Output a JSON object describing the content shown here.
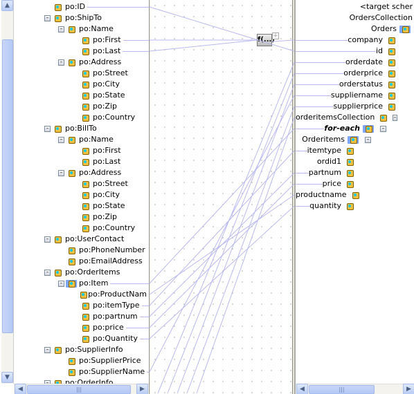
{
  "source_tree": [
    {
      "label": "po:ID",
      "level": 0,
      "toggle": false
    },
    {
      "label": "po:ShipTo",
      "level": 0,
      "toggle": true
    },
    {
      "label": "po:Name",
      "level": 1,
      "toggle": true
    },
    {
      "label": "po:First",
      "level": 2
    },
    {
      "label": "po:Last",
      "level": 2
    },
    {
      "label": "po:Address",
      "level": 1,
      "toggle": true
    },
    {
      "label": "po:Street",
      "level": 2
    },
    {
      "label": "po:City",
      "level": 2
    },
    {
      "label": "po:State",
      "level": 2
    },
    {
      "label": "po:Zip",
      "level": 2
    },
    {
      "label": "po:Country",
      "level": 2
    },
    {
      "label": "po:BillTo",
      "level": 0,
      "toggle": true
    },
    {
      "label": "po:Name",
      "level": 1,
      "toggle": true
    },
    {
      "label": "po:First",
      "level": 2
    },
    {
      "label": "po:Last",
      "level": 2
    },
    {
      "label": "po:Address",
      "level": 1,
      "toggle": true
    },
    {
      "label": "po:Street",
      "level": 2
    },
    {
      "label": "po:City",
      "level": 2
    },
    {
      "label": "po:State",
      "level": 2
    },
    {
      "label": "po:Zip",
      "level": 2
    },
    {
      "label": "po:Country",
      "level": 2
    },
    {
      "label": "po:UserContact",
      "level": 0,
      "toggle": true
    },
    {
      "label": "po:PhoneNumber",
      "level": 1
    },
    {
      "label": "po:EmailAddress",
      "level": 1
    },
    {
      "label": "po:OrderItems",
      "level": 0,
      "toggle": true
    },
    {
      "label": "po:Item",
      "level": 1,
      "toggle": true,
      "multi": true
    },
    {
      "label": "po:ProductNam",
      "level": 2
    },
    {
      "label": "po:itemType",
      "level": 2
    },
    {
      "label": "po:partnum",
      "level": 2
    },
    {
      "label": "po:price",
      "level": 2
    },
    {
      "label": "po:Quantity",
      "level": 2
    },
    {
      "label": "po:SupplierInfo",
      "level": 0,
      "toggle": true
    },
    {
      "label": "po:SupplierPrice",
      "level": 1
    },
    {
      "label": "po:SupplierName",
      "level": 1
    },
    {
      "label": "po:OrderInfo",
      "level": 0,
      "toggle": true
    }
  ],
  "target_tree": [
    {
      "label": "<target scher",
      "indent": 0,
      "icon": "none"
    },
    {
      "label": "OrdersCollection",
      "indent": 0,
      "icon": "none"
    },
    {
      "label": "Orders",
      "indent": 0,
      "icon": "multi"
    },
    {
      "label": "company",
      "indent": 0,
      "icon": "element"
    },
    {
      "label": "id",
      "indent": 0,
      "icon": "element"
    },
    {
      "label": "orderdate",
      "indent": 0,
      "icon": "element"
    },
    {
      "label": "orderprice",
      "indent": 0,
      "icon": "element"
    },
    {
      "label": "orderstatus",
      "indent": 0,
      "icon": "element"
    },
    {
      "label": "suppliername",
      "indent": 0,
      "icon": "element"
    },
    {
      "label": "supplierprice",
      "indent": 0,
      "icon": "element"
    },
    {
      "label": "orderitemsCollection",
      "indent": 0,
      "icon": "element",
      "toggle": true
    },
    {
      "label": "for-each",
      "indent": 1,
      "icon": "foreach",
      "toggle": true,
      "bold": true
    },
    {
      "label": "Orderitems",
      "indent": 2,
      "icon": "multi",
      "toggle": true
    },
    {
      "label": "itemtype",
      "indent": 3,
      "icon": "element"
    },
    {
      "label": "ordid1",
      "indent": 3,
      "icon": "element"
    },
    {
      "label": "partnum",
      "indent": 3,
      "icon": "element"
    },
    {
      "label": "price",
      "indent": 3,
      "icon": "element"
    },
    {
      "label": "productname",
      "indent": 3,
      "icon": "element"
    },
    {
      "label": "quantity",
      "indent": 3,
      "icon": "element"
    }
  ],
  "function_label": "f(...)",
  "mappings": [
    [
      0,
      4
    ],
    [
      3,
      "f"
    ],
    [
      4,
      "f"
    ],
    [
      "f",
      3
    ],
    [
      25,
      11
    ],
    [
      26,
      17
    ],
    [
      27,
      13
    ],
    [
      28,
      15
    ],
    [
      29,
      16
    ],
    [
      30,
      18
    ],
    [
      33,
      8
    ],
    [
      "below",
      5
    ],
    [
      "below",
      6
    ],
    [
      "below",
      7
    ],
    [
      "below",
      9
    ],
    [
      "below",
      10
    ]
  ],
  "colors": {
    "mapping_line": "#b8b8f0"
  }
}
